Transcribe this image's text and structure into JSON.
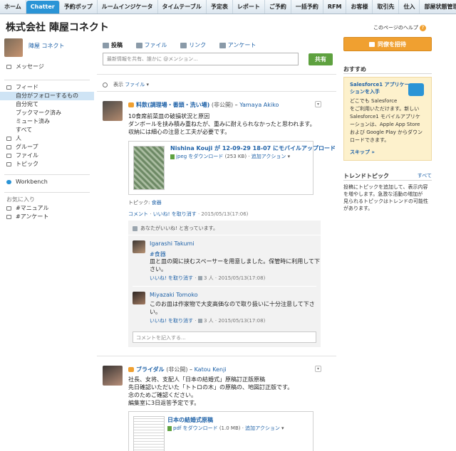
{
  "tabs": [
    "ホーム",
    "Chatter",
    "予約ボップ",
    "ルームインジケータ",
    "タイムテーブル",
    "予定表",
    "レポート",
    "ご予約",
    "一括予約",
    "RFM",
    "お客様",
    "取引先",
    "仕入",
    "部屋状態管理"
  ],
  "active_tab": "Chatter",
  "org_title": "株式会社 陣屋コネクト",
  "help_link": "このページのヘルプ",
  "sidebar": {
    "profile_name": "陣屋 コネクト",
    "messages": "メッセージ",
    "feed": "フィード",
    "feed_items": [
      "自分がフォローするもの",
      "自分宛て",
      "ブックマーク済み",
      "ミュート済み",
      "すべて"
    ],
    "people": "人",
    "groups": "グループ",
    "files": "ファイル",
    "topics": "トピック",
    "workbench": "Workbench",
    "favorites": "お気に入り",
    "fav_items": [
      "#マニュアル",
      "#アンケート"
    ]
  },
  "publisher": {
    "tabs": [
      "投稿",
      "ファイル",
      "リンク",
      "アンケート"
    ],
    "placeholder": "最新情報を共有、誰かに @メンション...",
    "share_label": "共有",
    "sort_label": "表示",
    "sort_value": "ファイル"
  },
  "post1": {
    "group": "料飲(調理場・番頭・洗い場)",
    "visibility": "(非公開)",
    "dash": "–",
    "author": "Yamaya Akiko",
    "body": [
      "10食席前菜皿の破損状況と原因",
      "ダンボールを挟み積み重ねたが、重みに耐えられなかったと思われます。",
      "収納には細心の注意と工夫が必要です。"
    ],
    "attachment_title": "Nishina Kouji が 12-09-29 18-07 にモバイルアップロード",
    "attachment_dl": "jpeg をダウンロード",
    "attachment_size": "(253 KB)",
    "attachment_action": "追加アクション",
    "topic_label": "トピック:",
    "topic": "食器",
    "comment": "コメント",
    "unlike": "いいね! を取り消す",
    "timestamp": "2015/05/13(17:06)",
    "likes_text": "あなたがいいね! と言っています。",
    "comments": [
      {
        "name": "Igarashi Takumi",
        "tag": "#食器",
        "lines": [
          "皿と皿の間に挟むスペーサーを用意しました。保管時に利用して下",
          "さい。"
        ],
        "unlike": "いいね! を取り消す",
        "likes": "3 人",
        "time": "2015/05/13(17:08)"
      },
      {
        "name": "Miyazaki Tomoko",
        "tag": "",
        "lines": [
          "このお皿は作家物で大変高価なので取り扱いに十分注意して下さ",
          "い。"
        ],
        "unlike": "いいね! を取り消す",
        "likes": "3 人",
        "time": "2015/05/13(17:08)"
      }
    ],
    "comment_placeholder": "コメントを記入する..."
  },
  "post2": {
    "group": "ブライダル",
    "visibility": "(非公開)",
    "dash": "–",
    "author": "Katou Kenji",
    "body": [
      "社長、女将、支配人「日本の結婚式」原稿訂正版原稿",
      "先日確認いただいた「トトロの木」の原稿の、地図訂正版です。",
      "念のためご確認ください。",
      "編集室に3日返答予定です。"
    ],
    "attachment_title": "日本の結婚式原稿",
    "attachment_dl": "pdf をダウンロード",
    "attachment_size": "(1.0 MB)",
    "attachment_action": "追加アクション"
  },
  "right": {
    "invite": "同僚を招待",
    "recommend": "おすすめ",
    "promo_title": [
      "Salesforce1 アプリケー",
      "ションを入手"
    ],
    "promo_body": [
      "どこでも Salesforce",
      "をご利用いただけます。新しい",
      "Salesforce1 モバイルアプリケ",
      "ーションは、Apple App Store",
      "および Google Play からダウン",
      "ロードできます。"
    ],
    "skip": "スキップ »",
    "trending": "トレンドトピック",
    "all": "すべて",
    "trend_text": [
      "投稿にトピックを追加して、表示内容",
      "を増やします。急激な活動の増加が",
      "見られるトピックはトレンドの可能性",
      "があります。"
    ]
  }
}
